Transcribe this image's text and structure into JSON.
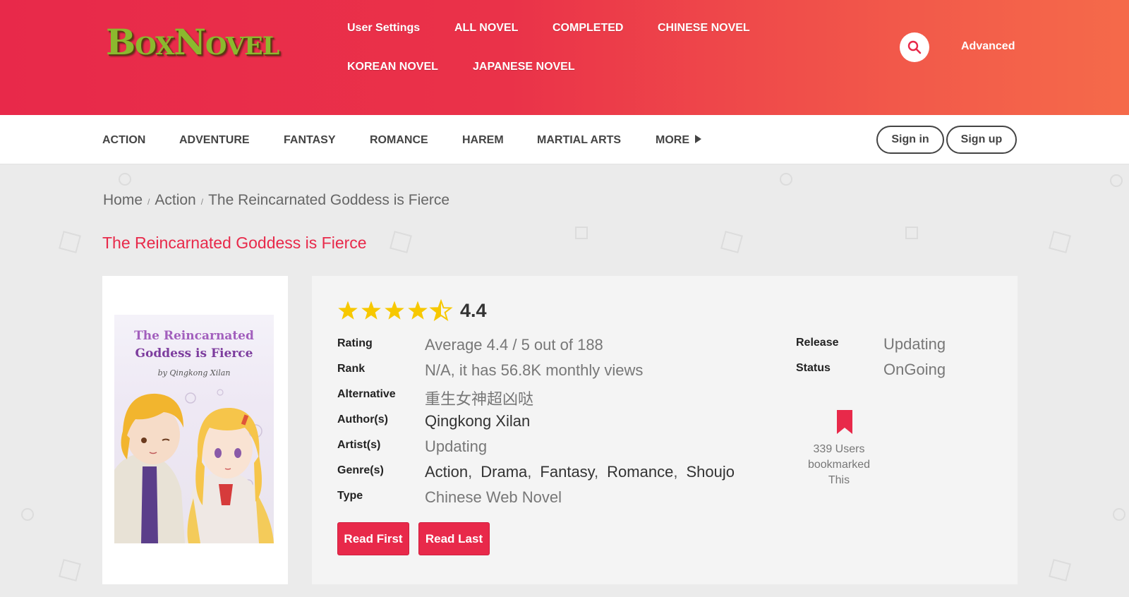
{
  "header": {
    "logo": "BoxNovel",
    "nav": [
      {
        "label": "User Settings"
      },
      {
        "label": "ALL NOVEL"
      },
      {
        "label": "COMPLETED"
      },
      {
        "label": "CHINESE NOVEL"
      },
      {
        "label": "KOREAN NOVEL"
      },
      {
        "label": "JAPANESE NOVEL"
      }
    ],
    "search_icon": "search-icon",
    "advanced_label": "Advanced"
  },
  "genres": [
    {
      "label": "ACTION"
    },
    {
      "label": "ADVENTURE"
    },
    {
      "label": "FANTASY"
    },
    {
      "label": "ROMANCE"
    },
    {
      "label": "HAREM"
    },
    {
      "label": "MARTIAL ARTS"
    },
    {
      "label": "MORE"
    }
  ],
  "auth": {
    "sign_in": "Sign in",
    "sign_up": "Sign up"
  },
  "breadcrumb": {
    "home": "Home",
    "category": "Action",
    "current": "The Reincarnated Goddess is Fierce"
  },
  "page_title": "The Reincarnated Goddess is Fierce",
  "cover": {
    "title_line1": "The Reincarnated",
    "title_line2": "Goddess is Fierce",
    "author_line": "by Qingkong Xilan"
  },
  "rating": {
    "stars": 4.4,
    "max": 5,
    "score_text": "4.4"
  },
  "details": {
    "rating": {
      "label": "Rating",
      "value": "Average 4.4 / 5 out of 188"
    },
    "rank": {
      "label": "Rank",
      "value": "N/A, it has 56.8K monthly views"
    },
    "alternative": {
      "label": "Alternative",
      "value": "重生女神超凶哒"
    },
    "authors": {
      "label": "Author(s)",
      "value": "Qingkong Xilan"
    },
    "artists": {
      "label": "Artist(s)",
      "value": "Updating"
    },
    "genres": {
      "label": "Genre(s)",
      "items": [
        "Action",
        "Drama",
        "Fantasy",
        "Romance",
        "Shoujo"
      ]
    },
    "type": {
      "label": "Type",
      "value": "Chinese Web Novel"
    },
    "release": {
      "label": "Release",
      "value": "Updating"
    },
    "status": {
      "label": "Status",
      "value": "OnGoing"
    }
  },
  "bookmark": {
    "line1": "339 Users",
    "line2": "bookmarked",
    "line3": "This"
  },
  "buttons": {
    "read_first": "Read First",
    "read_last": "Read Last"
  },
  "colors": {
    "brand_red": "#e8294a",
    "gradient_end": "#f56a4a",
    "star": "#f7c800"
  }
}
